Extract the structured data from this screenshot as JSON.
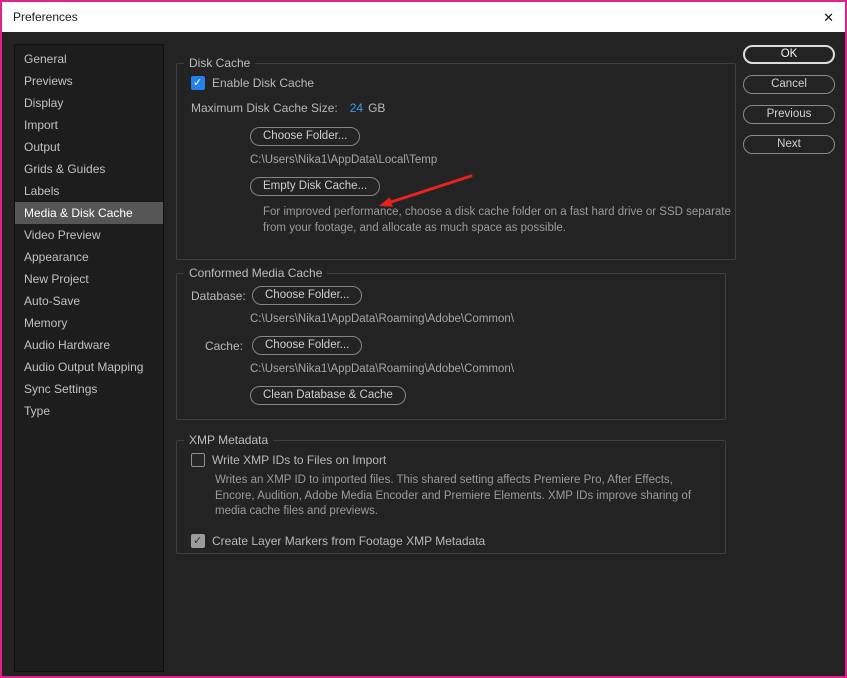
{
  "window": {
    "title": "Preferences",
    "close_icon": "✕"
  },
  "colors": {
    "frame_pink": "#e0218a",
    "accent_blue": "#3e9af0",
    "annotation_arrow": "#e8231f",
    "checkbox_blue": "#2680eb"
  },
  "sidebar": {
    "items": [
      {
        "label": "General"
      },
      {
        "label": "Previews"
      },
      {
        "label": "Display"
      },
      {
        "label": "Import"
      },
      {
        "label": "Output"
      },
      {
        "label": "Grids & Guides"
      },
      {
        "label": "Labels"
      },
      {
        "label": "Media & Disk Cache",
        "selected": true
      },
      {
        "label": "Video Preview"
      },
      {
        "label": "Appearance"
      },
      {
        "label": "New Project"
      },
      {
        "label": "Auto-Save"
      },
      {
        "label": "Memory"
      },
      {
        "label": "Audio Hardware"
      },
      {
        "label": "Audio Output Mapping"
      },
      {
        "label": "Sync Settings"
      },
      {
        "label": "Type"
      }
    ]
  },
  "dialog_buttons": {
    "ok": "OK",
    "cancel": "Cancel",
    "previous": "Previous",
    "next": "Next"
  },
  "disk_cache": {
    "title": "Disk Cache",
    "enable_label": "Enable Disk Cache",
    "enable_checked": true,
    "max_size_label": "Maximum Disk Cache Size:",
    "max_size_value": "24",
    "max_size_unit": "GB",
    "choose_folder_button": "Choose Folder...",
    "path": "C:\\Users\\Nika1\\AppData\\Local\\Temp",
    "empty_cache_button": "Empty Disk Cache...",
    "description": "For improved performance, choose a disk cache folder on a fast hard drive or SSD separate from your footage, and allocate as much space as possible."
  },
  "conformed_media_cache": {
    "title": "Conformed Media Cache",
    "database_label": "Database:",
    "database_choose_button": "Choose Folder...",
    "database_path": "C:\\Users\\Nika1\\AppData\\Roaming\\Adobe\\Common\\",
    "cache_label": "Cache:",
    "cache_choose_button": "Choose Folder...",
    "cache_path": "C:\\Users\\Nika1\\AppData\\Roaming\\Adobe\\Common\\",
    "clean_button": "Clean Database & Cache"
  },
  "xmp_metadata": {
    "title": "XMP Metadata",
    "write_ids_label": "Write XMP IDs to Files on Import",
    "write_ids_checked": false,
    "write_ids_description": "Writes an XMP ID to imported files. This shared setting affects Premiere Pro, After Effects, Encore, Audition, Adobe Media Encoder and Premiere Elements. XMP IDs improve sharing of media cache files and previews.",
    "layer_markers_label": "Create Layer Markers from Footage XMP Metadata",
    "layer_markers_checked": true
  }
}
